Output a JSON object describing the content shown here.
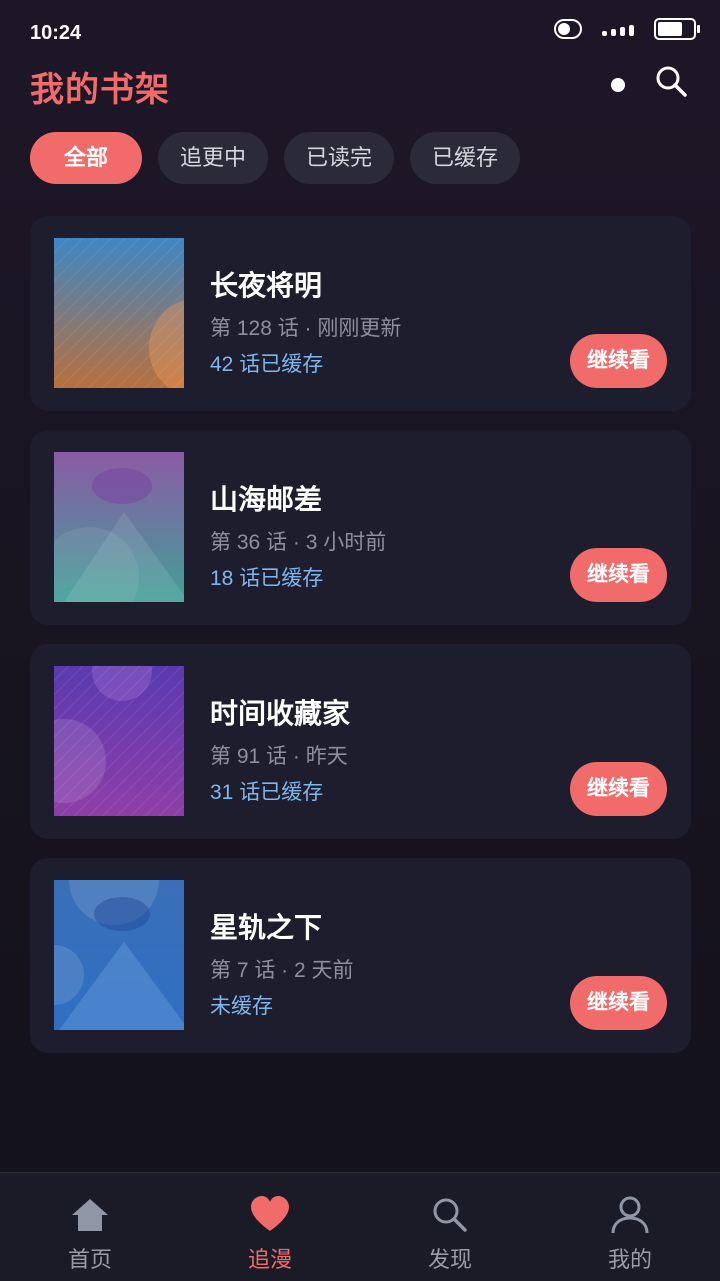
{
  "status_bar": {
    "time": "10:24"
  },
  "header": {
    "title": "我的书架"
  },
  "filters": [
    "全部",
    "追更中",
    "已读完",
    "已缓存"
  ],
  "books": [
    {
      "title": "长夜将明",
      "meta": "第 128 话 · 刚刚更新",
      "cache": "42 话已缓存",
      "action": "继续看"
    },
    {
      "title": "山海邮差",
      "meta": "第 36 话 · 3 小时前",
      "cache": "18 话已缓存",
      "action": "继续看"
    },
    {
      "title": "时间收藏家",
      "meta": "第 91 话 · 昨天",
      "cache": "31 话已缓存",
      "action": "继续看"
    },
    {
      "title": "星轨之下",
      "meta": "第 7 话 · 2 天前",
      "cache": "未缓存",
      "action": "继续看"
    }
  ],
  "tabbar": [
    {
      "label": "首页",
      "icon": "home-icon"
    },
    {
      "label": "追漫",
      "icon": "heart-icon"
    },
    {
      "label": "发现",
      "icon": "search-icon"
    },
    {
      "label": "我的",
      "icon": "user-icon"
    }
  ],
  "colors": {
    "accent": "#f26b6b",
    "card": "#1d1d2d",
    "cache_text": "#7fb6ec",
    "meta_text": "#8e8e9e"
  }
}
